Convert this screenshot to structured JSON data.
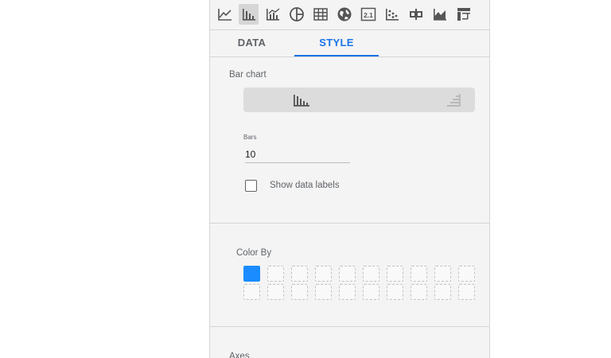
{
  "toolbar": {
    "icons": [
      "line-chart-icon",
      "bar-chart-icon",
      "combo-chart-icon",
      "pie-chart-icon",
      "table-icon",
      "geo-map-icon",
      "scorecard-icon",
      "scatter-chart-icon",
      "bullet-chart-icon",
      "area-chart-icon",
      "pivot-table-icon"
    ],
    "active": "bar-chart-icon",
    "scorecard_text": "2.1"
  },
  "tabs": {
    "data": "DATA",
    "style": "STYLE",
    "active": "STYLE"
  },
  "bar_chart": {
    "section_label": "Bar chart",
    "orientation": {
      "options": [
        "vertical-bars",
        "horizontal-bars"
      ],
      "selected": "vertical-bars"
    },
    "bars_label": "Bars",
    "bars_value": "10",
    "show_data_labels": {
      "label": "Show data labels",
      "checked": false
    }
  },
  "color_by": {
    "label": "Color By",
    "selected_color": "#1a8cff",
    "swatch_count": 20
  },
  "axes": {
    "label": "Axes"
  },
  "colors": {
    "accent": "#1a73e8",
    "panel_bg": "#f4f4f4"
  }
}
